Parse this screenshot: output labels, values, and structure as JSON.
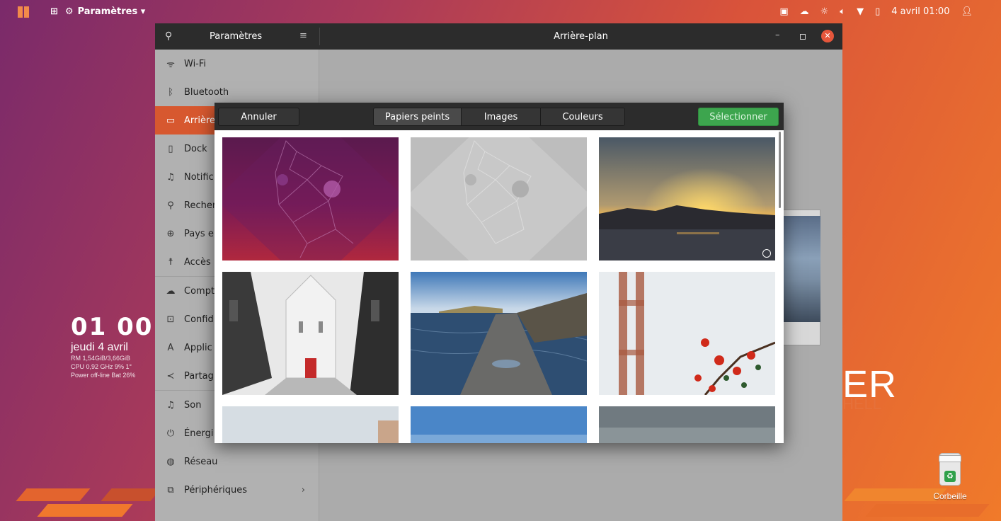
{
  "topbar": {
    "activities_icon": "apps-grid-icon",
    "app_icon": "settings-gear-icon",
    "app_name": "Paramètres ▾",
    "status_icons": [
      "terminal-icon",
      "cloud-icon",
      "brightness-icon",
      "volume-icon",
      "network-icon",
      "battery-icon"
    ],
    "datetime": "4 avril 01:00",
    "user_icon": "user-icon"
  },
  "desktop": {
    "clock": {
      "time": "01 00",
      "date": "jeudi 4 avril",
      "ram": "RM 1,54GiB/3,66GiB",
      "cpu": "CPU 0,92 GHz 9% 1°",
      "power": "Power off-line Bat 26%"
    },
    "brand_large": "ER",
    "brand_small": "HELL",
    "trash_label": "Corbeille"
  },
  "settings": {
    "sidebar_title": "Paramètres",
    "panel_title": "Arrière-plan",
    "sidebar_items": [
      {
        "label": "Wi-Fi",
        "icon": "wifi-icon"
      },
      {
        "label": "Bluetooth",
        "icon": "bluetooth-icon"
      },
      {
        "label": "Arrière",
        "icon": "display-icon",
        "active": true
      },
      {
        "label": "Dock",
        "icon": "dock-icon"
      },
      {
        "label": "Notific",
        "icon": "bell-icon"
      },
      {
        "label": "Recher",
        "icon": "search-icon"
      },
      {
        "label": "Pays e",
        "icon": "globe-icon"
      },
      {
        "label": "Accès",
        "icon": "accessibility-icon"
      },
      {
        "label": "Compt",
        "icon": "cloud-icon"
      },
      {
        "label": "Confid",
        "icon": "lock-icon"
      },
      {
        "label": "Applic",
        "icon": "apps-icon"
      },
      {
        "label": "Partag",
        "icon": "share-icon"
      },
      {
        "label": "Son",
        "icon": "music-note-icon"
      },
      {
        "label": "Énergi",
        "icon": "power-icon"
      },
      {
        "label": "Réseau",
        "icon": "network-globe-icon"
      },
      {
        "label": "Périphériques",
        "icon": "devices-icon",
        "chevron": "›"
      }
    ]
  },
  "chooser": {
    "cancel_label": "Annuler",
    "tabs": [
      {
        "label": "Papiers peints",
        "active": true
      },
      {
        "label": "Images",
        "active": false
      },
      {
        "label": "Couleurs",
        "active": false
      }
    ],
    "select_label": "Sélectionner",
    "thumbnails": [
      {
        "name": "ubuntu-purple-wallpaper",
        "selected": false
      },
      {
        "name": "ubuntu-grey-wallpaper",
        "selected": false
      },
      {
        "name": "sunset-lake-wallpaper",
        "selected": false,
        "timed": true
      },
      {
        "name": "church-street-wallpaper",
        "selected": false
      },
      {
        "name": "seawall-wallpaper",
        "selected": false
      },
      {
        "name": "bridge-flowers-wallpaper",
        "selected": false
      },
      {
        "name": "sky-wallpaper-1",
        "selected": false
      },
      {
        "name": "sky-wallpaper-2",
        "selected": false
      },
      {
        "name": "sky-wallpaper-3",
        "selected": false
      }
    ]
  },
  "colors": {
    "accent": "#d7582f",
    "select_green": "#3da54e",
    "close_red": "#e5563b"
  }
}
